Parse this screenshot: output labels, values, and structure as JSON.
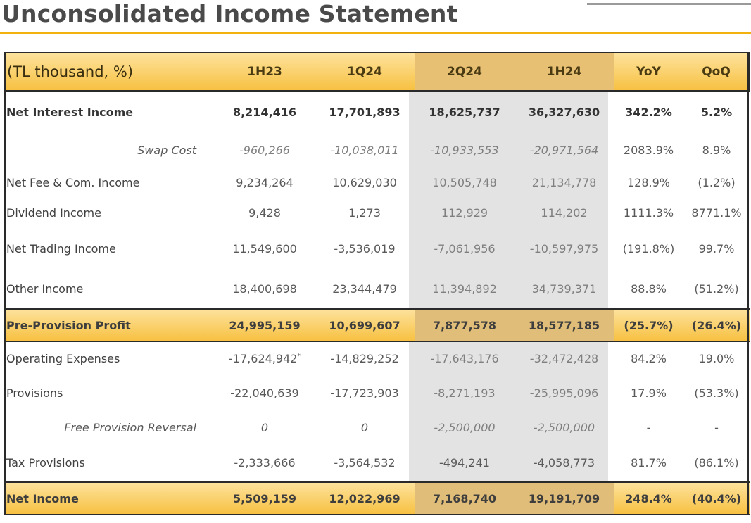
{
  "page_title": "Unconsolidated Income Statement",
  "colors": {
    "accent": "#f3b10f",
    "highlight_row": "#f7c142",
    "shaded_column": "#e3e3e3"
  },
  "table": {
    "header": [
      "(TL thousand, %)",
      "1H23",
      "1Q24",
      "2Q24",
      "1H24",
      "YoY",
      "QoQ"
    ],
    "rows": [
      {
        "label": "Net Interest Income",
        "cells": [
          "8,214,416",
          "17,701,893",
          "18,625,737",
          "36,327,630",
          "342.2%",
          "5.2%"
        ]
      },
      {
        "label": "Swap Cost",
        "cells": [
          "-960,266",
          "-10,038,011",
          "-10,933,553",
          "-20,971,564",
          "2083.9%",
          "8.9%"
        ]
      },
      {
        "label": "Net Fee & Com. Income",
        "cells": [
          "9,234,264",
          "10,629,030",
          "10,505,748",
          "21,134,778",
          "128.9%",
          "(1.2%)"
        ]
      },
      {
        "label": "Dividend Income",
        "cells": [
          "9,428",
          "1,273",
          "112,929",
          "114,202",
          "1111.3%",
          "8771.1%"
        ]
      },
      {
        "label": "Net Trading Income",
        "cells": [
          "11,549,600",
          "-3,536,019",
          "-7,061,956",
          "-10,597,975",
          "(191.8%)",
          "99.7%"
        ]
      },
      {
        "label": "Other Income",
        "cells": [
          "18,400,698",
          "23,344,479",
          "11,394,892",
          "34,739,371",
          "88.8%",
          "(51.2%)"
        ]
      },
      {
        "label": "Pre-Provision Profit",
        "cells": [
          "24,995,159",
          "10,699,607",
          "7,877,578",
          "18,577,185",
          "(25.7%)",
          "(26.4%)"
        ]
      },
      {
        "label": "Operating Expenses",
        "cells": [
          "-17,624,942",
          "-14,829,252",
          "-17,643,176",
          "-32,472,428",
          "84.2%",
          "19.0%"
        ],
        "note": "*"
      },
      {
        "label": "Provisions",
        "cells": [
          "-22,040,639",
          "-17,723,903",
          "-8,271,193",
          "-25,995,096",
          "17.9%",
          "(53.3%)"
        ]
      },
      {
        "label": "Free Provision Reversal",
        "cells": [
          "0",
          "0",
          "-2,500,000",
          "-2,500,000",
          "-",
          "-"
        ]
      },
      {
        "label": "Tax Provisions",
        "cells": [
          "-2,333,666",
          "-3,564,532",
          "-494,241",
          "-4,058,773",
          "81.7%",
          "(86.1%)"
        ]
      },
      {
        "label": "Net Income",
        "cells": [
          "5,509,159",
          "12,022,969",
          "7,168,740",
          "19,191,709",
          "248.4%",
          "(40.4%)"
        ]
      }
    ]
  }
}
